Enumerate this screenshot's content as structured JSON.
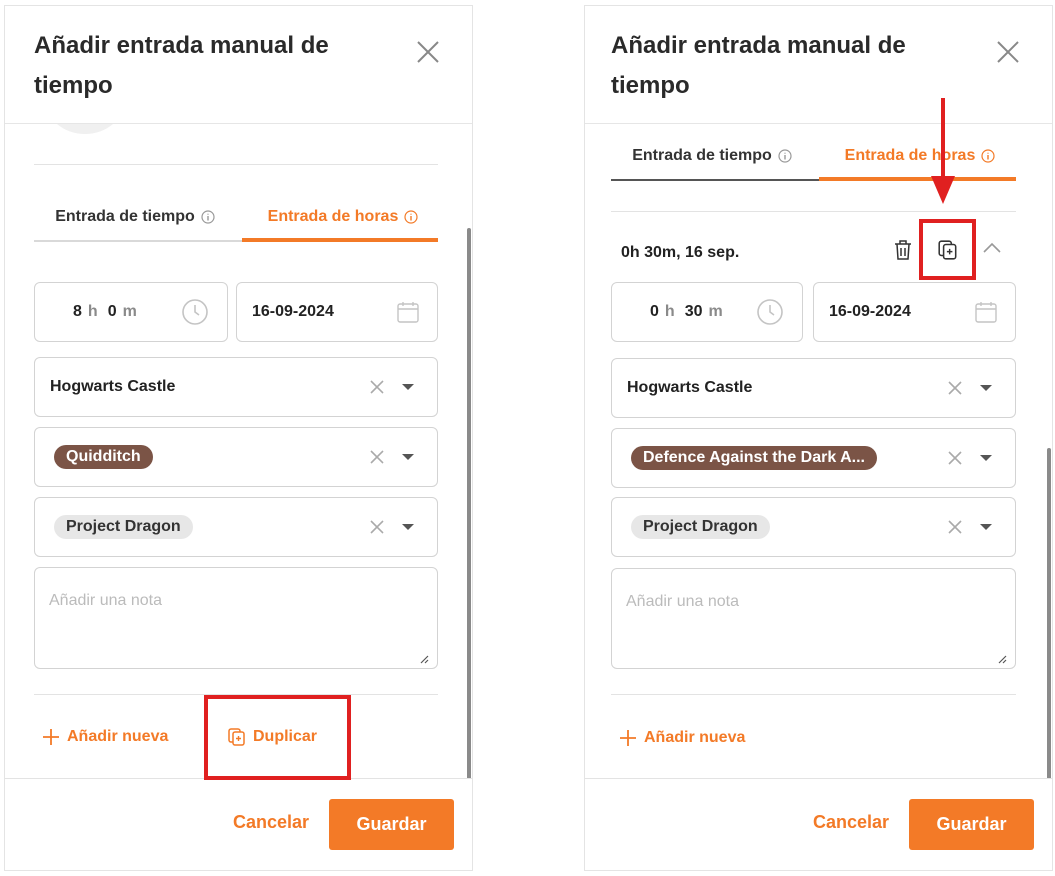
{
  "left_panel": {
    "title": "Añadir entrada manual de tiempo",
    "tabs": [
      {
        "label": "Entrada de tiempo",
        "active": false
      },
      {
        "label": "Entrada de horas",
        "active": true
      }
    ],
    "duration": {
      "hours": "8",
      "hours_unit": "h",
      "minutes": "0",
      "minutes_unit": "m"
    },
    "date": "16-09-2024",
    "project": "Hogwarts Castle",
    "task": "Quidditch",
    "tag": "Project Dragon",
    "note_placeholder": "Añadir una nota",
    "add_new_label": "Añadir nueva",
    "duplicate_label": "Duplicar",
    "footer": {
      "cancel_label": "Cancelar",
      "save_label": "Guardar"
    }
  },
  "right_panel": {
    "title": "Añadir entrada manual de tiempo",
    "tabs": [
      {
        "label": "Entrada de tiempo",
        "active": false
      },
      {
        "label": "Entrada de horas",
        "active": true
      }
    ],
    "entry_summary": "0h 30m, 16 sep.",
    "duration": {
      "hours": "0",
      "hours_unit": "h",
      "minutes": "30",
      "minutes_unit": "m"
    },
    "date": "16-09-2024",
    "project": "Hogwarts Castle",
    "task": "Defence Against the Dark A...",
    "tag": "Project Dragon",
    "note_placeholder": "Añadir una nota",
    "add_new_label": "Añadir nueva",
    "footer": {
      "cancel_label": "Cancelar",
      "save_label": "Guardar"
    }
  },
  "colors": {
    "accent": "#f37a27",
    "task_chip": "#7b5446",
    "tag_chip": "#e7e7e7",
    "highlight": "#e02020"
  },
  "icons": [
    "close-icon",
    "info-icon",
    "clock-icon",
    "calendar-icon",
    "clear-icon",
    "caret-down-icon",
    "resize-icon",
    "plus-icon",
    "duplicate-icon",
    "trash-icon",
    "chevron-up-icon"
  ]
}
